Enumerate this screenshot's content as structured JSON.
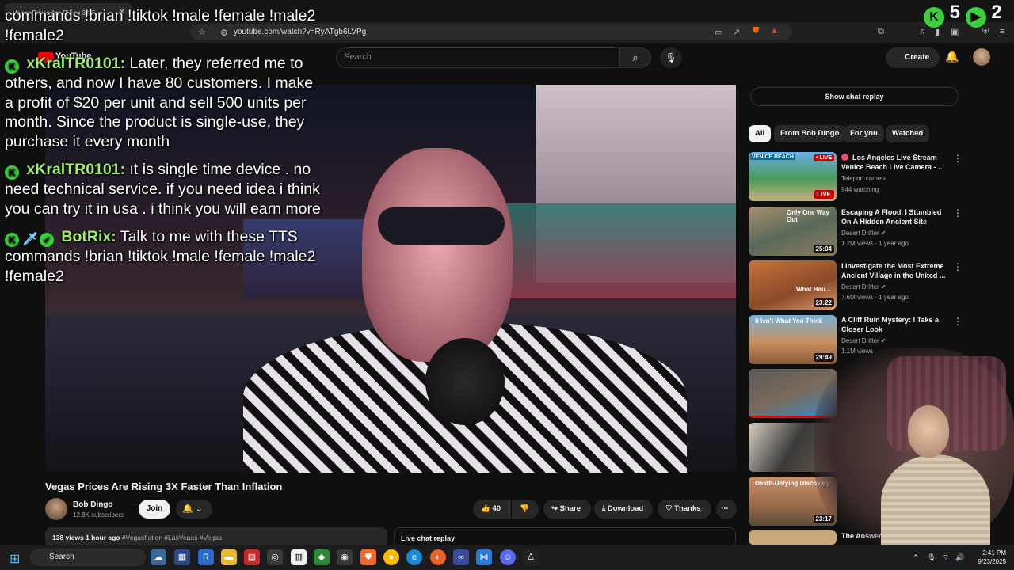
{
  "browser": {
    "tab_title": "Vegas Prices Are Rising 3X F...",
    "url": "youtube.com/watch?v=RyATgb6LVPg"
  },
  "youtube": {
    "logo_text": "YouTube",
    "search_placeholder": "Search",
    "create_label": "Create"
  },
  "stream_overlay": {
    "counter_value": "5",
    "counter_value_2": "2",
    "chat": [
      {
        "badges": [
          "kick"
        ],
        "user": "",
        "text": "commands !brian !tiktok !male !female !male2 !female2"
      },
      {
        "badges": [
          "kick"
        ],
        "user": "xKralTR0101:",
        "text": "Later, they referred me to others, and now I have 80 customers. I make a profit of $20 per unit and sell 500 units per month. Since the product is single-use, they purchase it every month"
      },
      {
        "badges": [
          "kick"
        ],
        "user": "xKralTR0101:",
        "text": "ıt is single time device . no need technical service. if you need idea i think you can try it in usa . i think you will earn more"
      },
      {
        "badges": [
          "kick",
          "sword",
          "verified"
        ],
        "user": "BotRix:",
        "text": "Talk to me with these TTS commands !brian !tiktok !male !female !male2 !female2"
      }
    ]
  },
  "video": {
    "title": "Vegas Prices Are Rising 3X Faster Than Inflation",
    "channel": "Bob Dingo",
    "subscribers": "12.8K subscribers",
    "join_label": "Join",
    "like_count": "40",
    "share_label": "Share",
    "download_label": "Download",
    "thanks_label": "Thanks",
    "views": "138 views",
    "time_ago": "1 hour ago",
    "tags": "#Vegasflation #LasVegas #Vegas",
    "live_chat_replay": "Live chat replay"
  },
  "sidebar": {
    "show_chat_replay": "Show chat replay",
    "chips": [
      "All",
      "From Bob Dingo",
      "For you",
      "Watched"
    ],
    "recommendations": [
      {
        "title": "Los Angeles Live Stream -Venice Beach Live Camera - ...",
        "channel": "Teleport.camera",
        "meta": "944 watching",
        "duration": "LIVE",
        "thumb_label": "VENICE BEACH",
        "live": true
      },
      {
        "title": "Escaping A Flood, I Stumbled On A Hidden Ancient Site",
        "channel": "Desert Drifter ✔",
        "meta": "1.2M views · 1 year ago",
        "duration": "25:04",
        "thumb_label": "Only One Way Out"
      },
      {
        "title": "I Investigate the Most Extreme Ancient Village in the United ...",
        "channel": "Desert Drifter ✔",
        "meta": "7.6M views · 1 year ago",
        "duration": "23:22",
        "thumb_label": "What Hau..."
      },
      {
        "title": "A Cliff Ruin Mystery: I Take a Closer Look",
        "channel": "Desert Drifter ✔",
        "meta": "1.1M views",
        "duration": "29:49",
        "thumb_label": "It Isn't What You Think"
      },
      {
        "title": "",
        "channel": "",
        "meta": "",
        "duration": "",
        "thumb_label": ""
      },
      {
        "title": "",
        "channel": "",
        "meta": "",
        "duration": "",
        "thumb_label": ""
      },
      {
        "title": "",
        "channel": "",
        "meta": "",
        "duration": "23:17",
        "thumb_label": "Death-Defying Discovery"
      },
      {
        "title": "The Answers You've Always",
        "channel": "",
        "meta": "",
        "duration": "",
        "thumb_label": ""
      }
    ]
  },
  "taskbar": {
    "search_label": "Search",
    "time": "2:41 PM",
    "date": "9/23/2025"
  }
}
